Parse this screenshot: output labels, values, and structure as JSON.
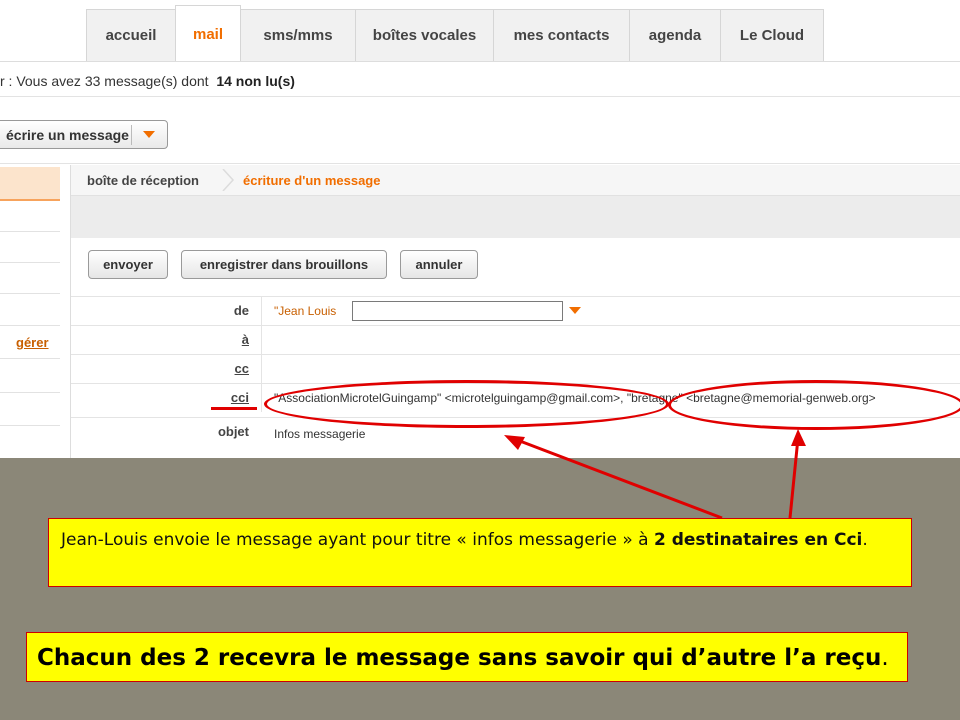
{
  "tabs": [
    "accueil",
    "mail",
    "sms/mms",
    "boîtes vocales",
    "mes contacts",
    "agenda",
    "Le Cloud"
  ],
  "active_tab": "mail",
  "status": {
    "prefix": "r : Vous avez 33 message(s) dont",
    "unread": "14 non lu(s)"
  },
  "toolbar": {
    "write_label": "écrire un message"
  },
  "sidebar": {
    "manage_link": "gérer"
  },
  "breadcrumb": {
    "inbox": "boîte de réception",
    "current": "écriture d'un message"
  },
  "compose_buttons": {
    "send": "envoyer",
    "save_draft": "enregistrer dans brouillons",
    "cancel": "annuler"
  },
  "fields": {
    "from_label": "de",
    "from_value": "\"Jean Louis",
    "to_label": "à",
    "cc_label": "cc",
    "bcc_label": "cci",
    "bcc_value": "\"AssociationMicrotelGuingamp\" <microtelguingamp@gmail.com>, \"bretagne\" <bretagne@memorial-genweb.org>",
    "subject_label": "objet",
    "subject_value": "Infos messagerie"
  },
  "annotation": {
    "note1_text": "Jean-Louis envoie le message ayant pour titre « infos messagerie » à ",
    "note1_bold": "2 destinataires en Cci",
    "note1_end": ".",
    "note2_bold": "Chacun des 2 recevra le message sans savoir qui d’autre l’a reçu",
    "note2_end": "."
  },
  "colors": {
    "accent_orange": "#f16e00",
    "annotation_red": "#e00000",
    "note_yellow": "#ffff00"
  }
}
